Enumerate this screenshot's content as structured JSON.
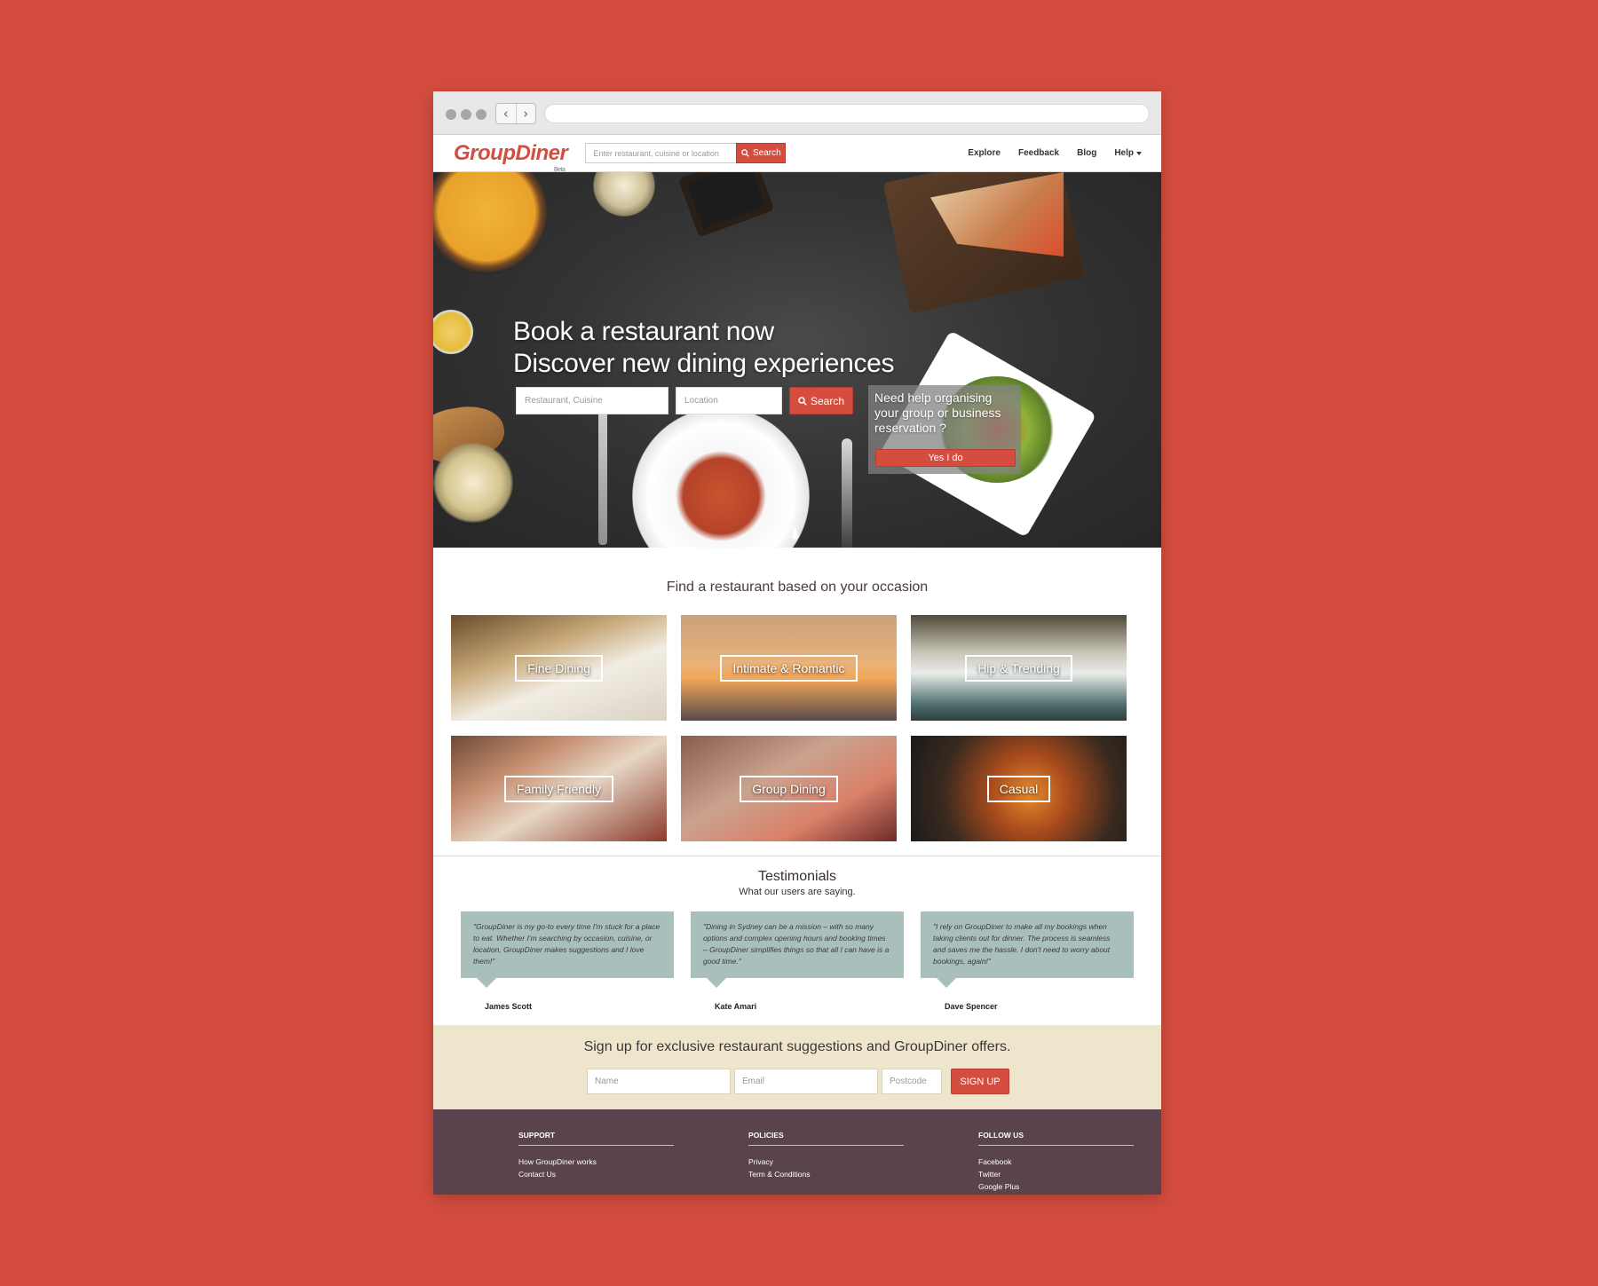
{
  "colors": {
    "background": "#d44d3e",
    "brand_red": "#d44d3e",
    "quote_bg": "#a9bfbb",
    "signup_bg": "#ede6cc",
    "footer_bg": "#5a434d"
  },
  "header": {
    "logo": "GroupDiner",
    "logo_badge": "Beta",
    "search_placeholder": "Enter restaurant, cuisine or location",
    "search_button": "Search",
    "search_icon": "search-icon",
    "nav": [
      "Explore",
      "Feedback",
      "Blog",
      "Help"
    ],
    "help_caret_icon": "caret-down-icon"
  },
  "hero": {
    "title_line1": "Book a restaurant now",
    "title_line2": "Discover new dining experiences",
    "cuisine_placeholder": "Restaurant, Cuisine",
    "location_placeholder": "Location",
    "search_button": "Search",
    "help_text": "Need help organising your group or business reservation ?",
    "help_button": "Yes I do",
    "scroll_icon": "arrow-down-icon"
  },
  "occasions": {
    "title": "Find a restaurant based on your occasion",
    "items": [
      "Fine Dining",
      "Intimate & Romantic",
      "Hip & Trending",
      "Family Friendly",
      "Group Dining",
      "Casual"
    ]
  },
  "testimonials": {
    "title": "Testimonials",
    "subtitle": "What our users are saying.",
    "items": [
      {
        "quote": "\"GroupDiner is my go-to every time I'm stuck for a place to eat. Whether I'm searching by occasion, cuisine, or location, GroupDiner makes suggestions and I love them!\"",
        "author": "James Scott"
      },
      {
        "quote": "\"Dining in Sydney can be a mission – with so many options and complex opening hours and booking times – GroupDiner simplifies things so that all I can have is a good time.\"",
        "author": "Kate Amari"
      },
      {
        "quote": "\"I rely on GroupDiner to make all my bookings when taking clients out for dinner. The process is seamless and saves me the hassle. I don't need to worry about bookings, again!\"",
        "author": "Dave Spencer"
      }
    ]
  },
  "signup": {
    "title": "Sign up for exclusive restaurant suggestions and GroupDiner offers.",
    "name_placeholder": "Name",
    "email_placeholder": "Email",
    "postcode_placeholder": "Postcode",
    "button": "SIGN UP"
  },
  "footer": {
    "columns": [
      {
        "heading": "SUPPORT",
        "links": [
          "How GroupDiner works",
          "Contact Us"
        ]
      },
      {
        "heading": "POLICIES",
        "links": [
          "Privacy",
          "Term & Conditions"
        ]
      },
      {
        "heading": "FOLLOW US",
        "links": [
          "Facebook",
          "Twitter",
          "Google Plus"
        ]
      }
    ]
  }
}
